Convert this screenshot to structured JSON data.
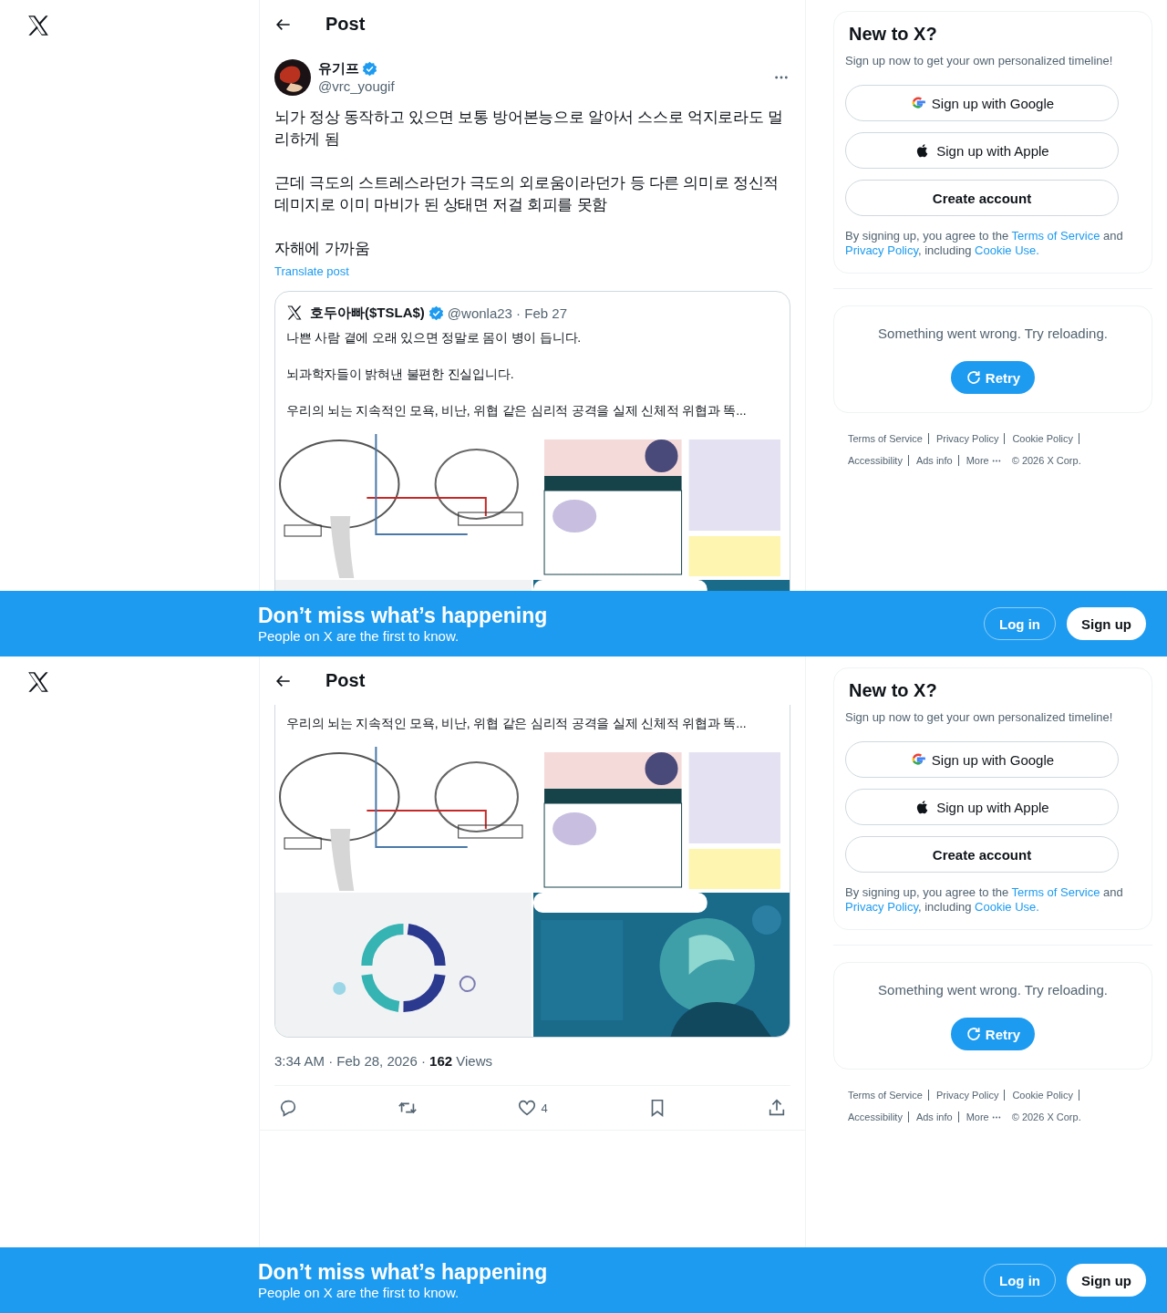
{
  "views": [
    {
      "header": {
        "title": "Post"
      },
      "post": {
        "author": {
          "name": "유기프",
          "handle": "@vrc_yougif",
          "verified": true
        },
        "paragraphs": [
          "뇌가 정상 동작하고 있으면 보통 방어본능으로 알아서 스스로 억지로라도 멀리하게 됨",
          "근데 극도의 스트레스라던가 극도의 외로움이라던가 등 다른 의미로 정신적 데미지로 이미 마비가 된 상태면 저걸 회피를 못함",
          "자해에 가까움"
        ],
        "translate": "Translate post",
        "quote": {
          "author": {
            "name": "호두아빠($TSLA$)",
            "meta": "@wonla23 · Feb 27",
            "verified": true
          },
          "paragraphs": [
            "나쁜 사람 곁에 오래 있으면 정말로 몸이 병이 듭니다.",
            "뇌과학자들이 밝혀낸 불편한 진실입니다.",
            "우리의 뇌는 지속적인 모욕, 비난, 위협 같은 심리적 공격을 실제 신체적 위협과 똑..."
          ],
          "media": [
            {
              "kind": "picture"
            },
            {
              "kind": "picture"
            },
            {
              "kind": "picture"
            },
            {
              "kind": "picture"
            }
          ]
        }
      },
      "sidebar": {
        "title": "New to X?",
        "subtitle": "Sign up now to get your own personalized timeline!",
        "buttons": [
          {
            "kind": "google",
            "label": "Sign up with Google"
          },
          {
            "kind": "apple",
            "label": "Sign up with Apple"
          },
          {
            "kind": "plain",
            "label": "Create account"
          }
        ],
        "legal": [
          {
            "text": "By signing up, you agree to the ",
            "link": false
          },
          {
            "text": "Terms of Service",
            "link": true
          },
          {
            "text": " and ",
            "link": false
          },
          {
            "text": "Privacy Policy",
            "link": true
          },
          {
            "text": ", including ",
            "link": false
          },
          {
            "text": "Cookie Use.",
            "link": true
          }
        ],
        "error": {
          "message": "Something went wrong. Try reloading.",
          "retry": "Retry"
        }
      },
      "footer": {
        "links": [
          "Terms of Service",
          "Privacy Policy",
          "Cookie Policy",
          "Accessibility",
          "Ads info"
        ],
        "more": "More",
        "copyright": "© 2026 X Corp."
      },
      "banner": {
        "title": "Don’t miss what’s happening",
        "subtitle": "People on X are the first to know.",
        "login": "Log in",
        "signup": "Sign up"
      }
    },
    {
      "header": {
        "title": "Post"
      },
      "post": {
        "quote": {
          "paragraphs": [
            "우리의 뇌는 지속적인 모욕, 비난, 위협 같은 심리적 공격을 실제 신체적 위협과 똑..."
          ],
          "media": [
            {
              "kind": "picture"
            },
            {
              "kind": "picture"
            },
            {
              "kind": "picture"
            },
            {
              "kind": "picture"
            }
          ]
        },
        "timestamp": "3:34 AM · Feb 28, 2026 · **162** Views",
        "actions": [
          {
            "kind": "reply"
          },
          {
            "kind": "repost"
          },
          {
            "kind": "like",
            "count": "4"
          },
          {
            "kind": "bookmark"
          },
          {
            "kind": "share"
          }
        ]
      },
      "sidebar": {
        "title": "New to X?",
        "subtitle": "Sign up now to get your own personalized timeline!",
        "buttons": [
          {
            "kind": "google",
            "label": "Sign up with Google"
          },
          {
            "kind": "apple",
            "label": "Sign up with Apple"
          },
          {
            "kind": "plain",
            "label": "Create account"
          }
        ],
        "legal": [
          {
            "text": "By signing up, you agree to the ",
            "link": false
          },
          {
            "text": "Terms of Service",
            "link": true
          },
          {
            "text": " and ",
            "link": false
          },
          {
            "text": "Privacy Policy",
            "link": true
          },
          {
            "text": ", including ",
            "link": false
          },
          {
            "text": "Cookie Use.",
            "link": true
          }
        ],
        "error": {
          "message": "Something went wrong. Try reloading.",
          "retry": "Retry"
        }
      },
      "footer": {
        "links": [
          "Terms of Service",
          "Privacy Policy",
          "Cookie Policy",
          "Accessibility",
          "Ads info"
        ],
        "more": "More",
        "copyright": "© 2026 X Corp."
      },
      "banner": {
        "title": "Don’t miss what’s happening",
        "subtitle": "People on X are the first to know.",
        "login": "Log in",
        "signup": "Sign up"
      }
    }
  ]
}
